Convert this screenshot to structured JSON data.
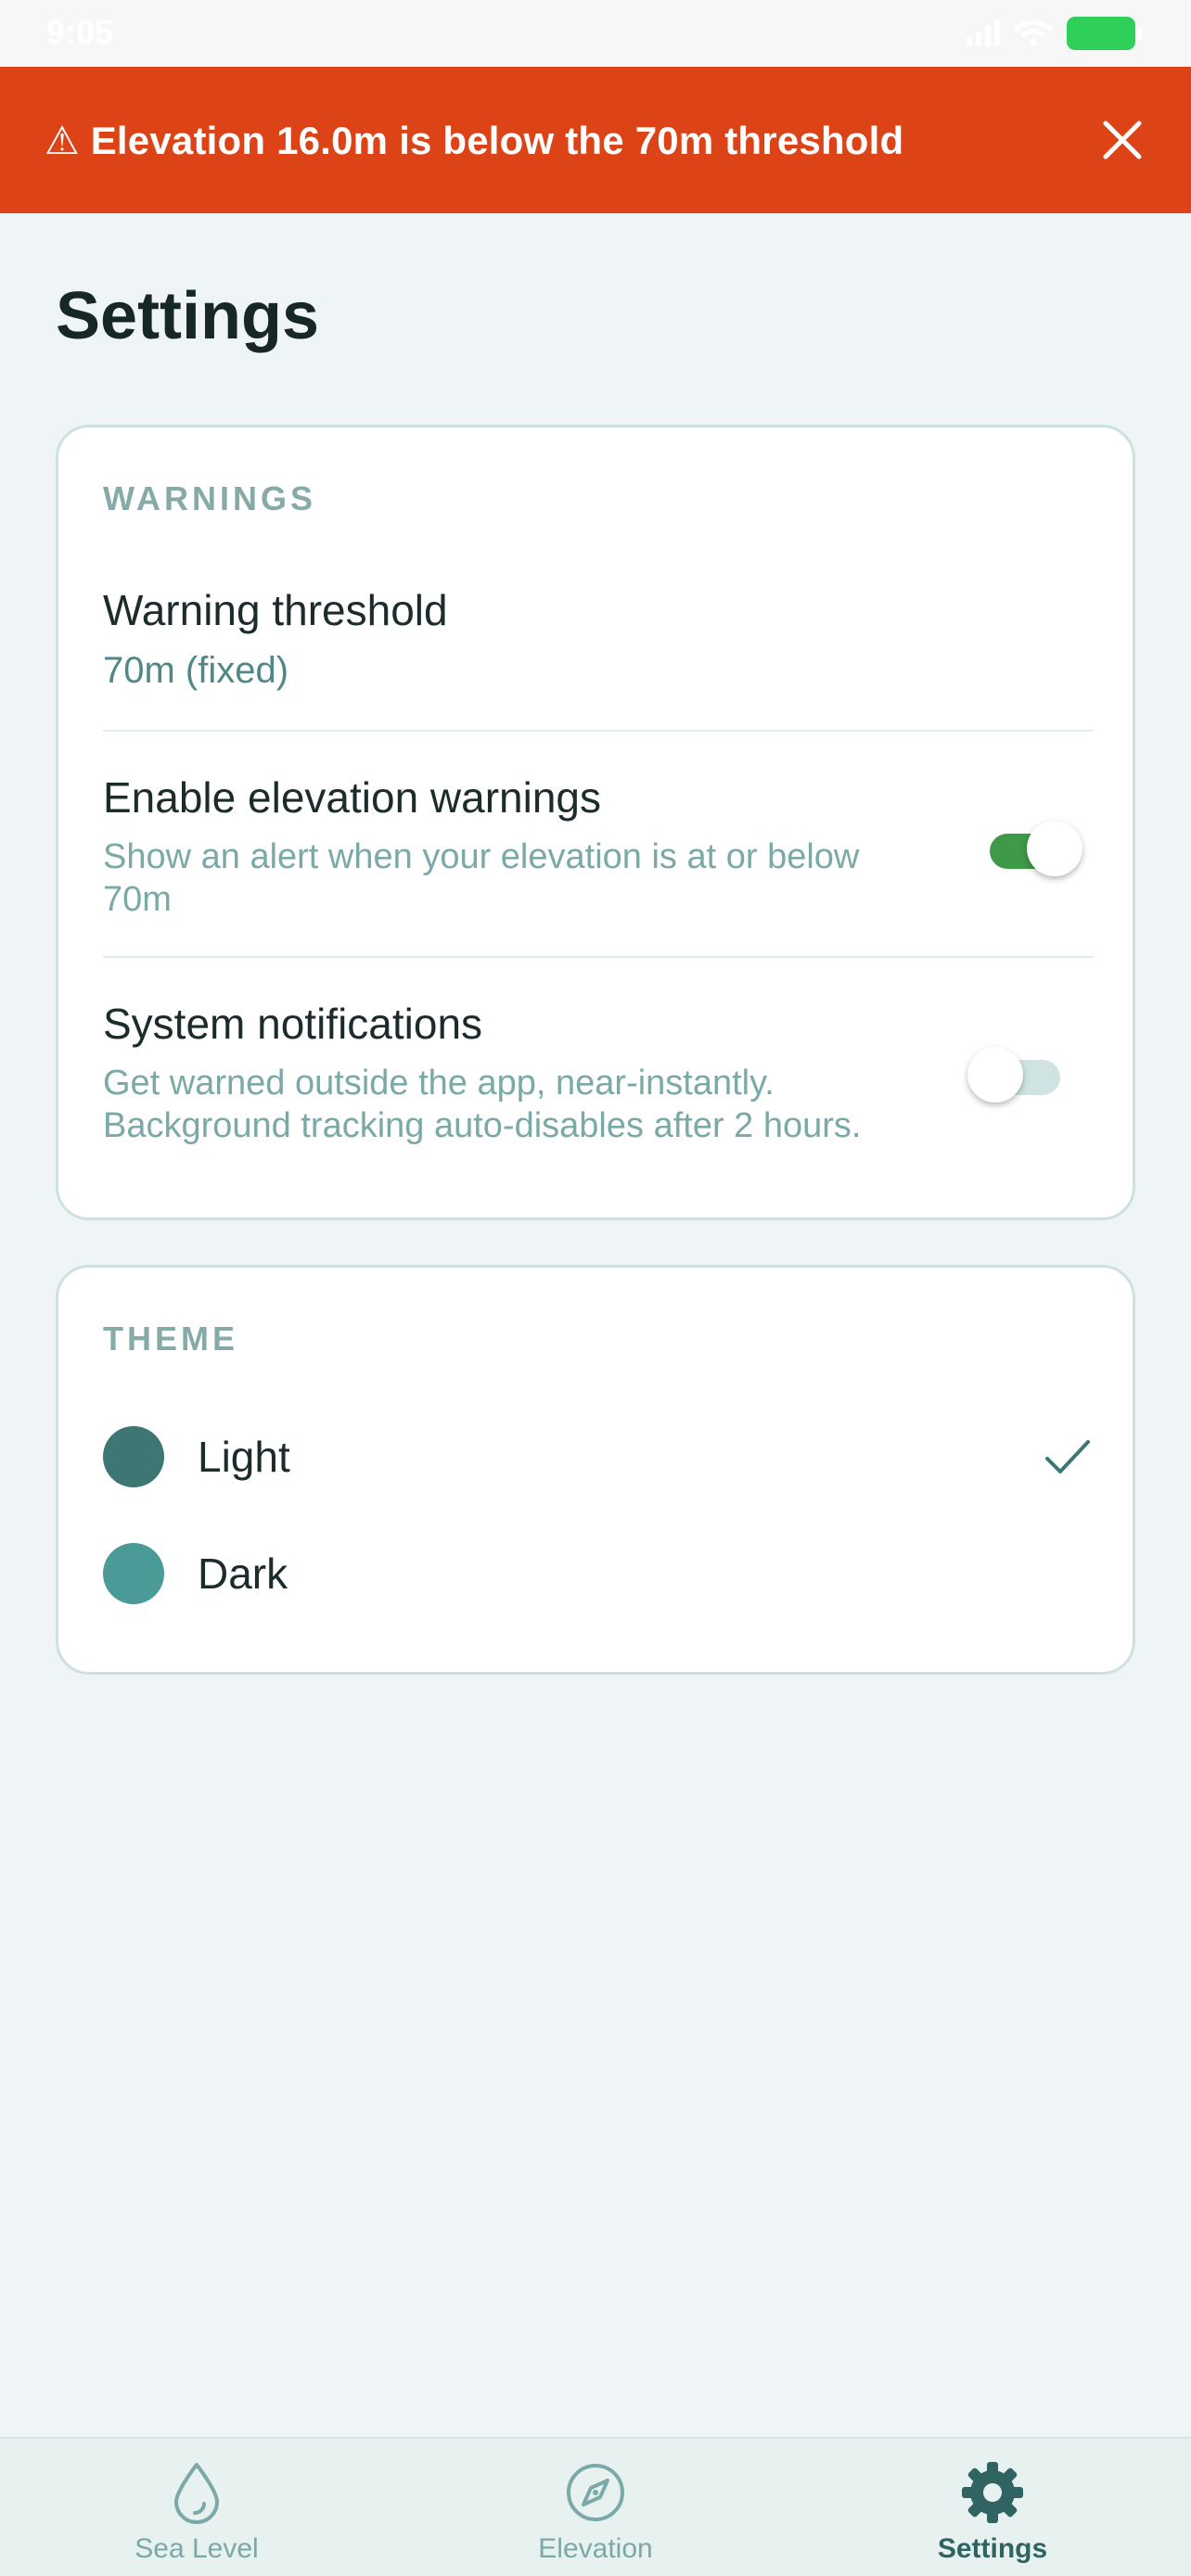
{
  "status_bar": {
    "time": "9:05"
  },
  "banner": {
    "text": "⚠ Elevation 16.0m is below the 70m threshold",
    "color": "#dc4317",
    "close_icon": "close-icon"
  },
  "page": {
    "title": "Settings"
  },
  "warnings": {
    "section_title": "WARNINGS",
    "threshold": {
      "title": "Warning threshold",
      "value": "70m (fixed)"
    },
    "elevation_warnings": {
      "title": "Enable elevation warnings",
      "subtitle_line1": "Show an alert when your elevation is at or below",
      "subtitle_line2": "70m",
      "enabled": true
    },
    "system_notifications": {
      "title": "System notifications",
      "subtitle_line1": "Get warned outside the app, near-instantly.",
      "subtitle_line2": "Background tracking auto-disables after 2 hours.",
      "enabled": false
    }
  },
  "theme": {
    "section_title": "THEME",
    "options": [
      {
        "label": "Light",
        "swatch_color": "#3d7672",
        "selected": true
      },
      {
        "label": "Dark",
        "swatch_color": "#4a9b97",
        "selected": false
      }
    ]
  },
  "bottom_nav": {
    "items": [
      {
        "label": "Sea Level",
        "icon": "droplet-icon",
        "active": false
      },
      {
        "label": "Elevation",
        "icon": "compass-icon",
        "active": false
      },
      {
        "label": "Settings",
        "icon": "gear-icon",
        "active": true
      }
    ]
  },
  "colors": {
    "accent": "#3d7672",
    "toggle_on": "#3f9a48",
    "muted_text": "#7ba9a7"
  }
}
